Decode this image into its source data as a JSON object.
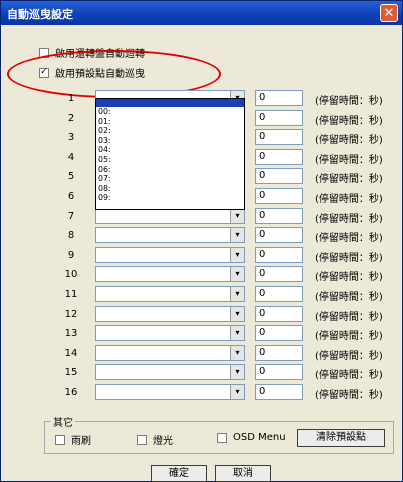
{
  "window": {
    "title": "自動巡曳設定",
    "close_glyph": "✕"
  },
  "options": {
    "auto_rotate": {
      "label": "啟用還轉盤自動迴轉",
      "checked": false
    },
    "preset_tour": {
      "label": "啟用預設點自動巡曳",
      "checked": true,
      "check_glyph": "✓"
    }
  },
  "dropdown_arrow": "▾",
  "dwell_hint": "(停留時間：秒)",
  "rows": [
    {
      "num": "1",
      "preset": "",
      "dwell": "0"
    },
    {
      "num": "2",
      "preset": "",
      "dwell": "0"
    },
    {
      "num": "3",
      "preset": "",
      "dwell": "0"
    },
    {
      "num": "4",
      "preset": "",
      "dwell": "0"
    },
    {
      "num": "5",
      "preset": "",
      "dwell": "0"
    },
    {
      "num": "6",
      "preset": "",
      "dwell": "0"
    },
    {
      "num": "7",
      "preset": "",
      "dwell": "0"
    },
    {
      "num": "8",
      "preset": "",
      "dwell": "0"
    },
    {
      "num": "9",
      "preset": "",
      "dwell": "0"
    },
    {
      "num": "10",
      "preset": "",
      "dwell": "0"
    },
    {
      "num": "11",
      "preset": "",
      "dwell": "0"
    },
    {
      "num": "12",
      "preset": "",
      "dwell": "0"
    },
    {
      "num": "13",
      "preset": "",
      "dwell": "0"
    },
    {
      "num": "14",
      "preset": "",
      "dwell": "0"
    },
    {
      "num": "15",
      "preset": "",
      "dwell": "0"
    },
    {
      "num": "16",
      "preset": "",
      "dwell": "0"
    }
  ],
  "dropdown": {
    "items": [
      "00:",
      "01:",
      "02:",
      "03:",
      "04:",
      "05:",
      "06:",
      "07:",
      "08:",
      "09:"
    ]
  },
  "other_group": {
    "title": "其它",
    "wiper": "雨刷",
    "light": "燈光",
    "osd_menu": "OSD Menu",
    "clear_presets": "清除預設點"
  },
  "footer": {
    "ok": "確定",
    "cancel": "取消"
  },
  "colors": {
    "title_bar": "#0b3fb8",
    "highlight": "#e00000",
    "dialog_bg": "#ece9d8"
  }
}
